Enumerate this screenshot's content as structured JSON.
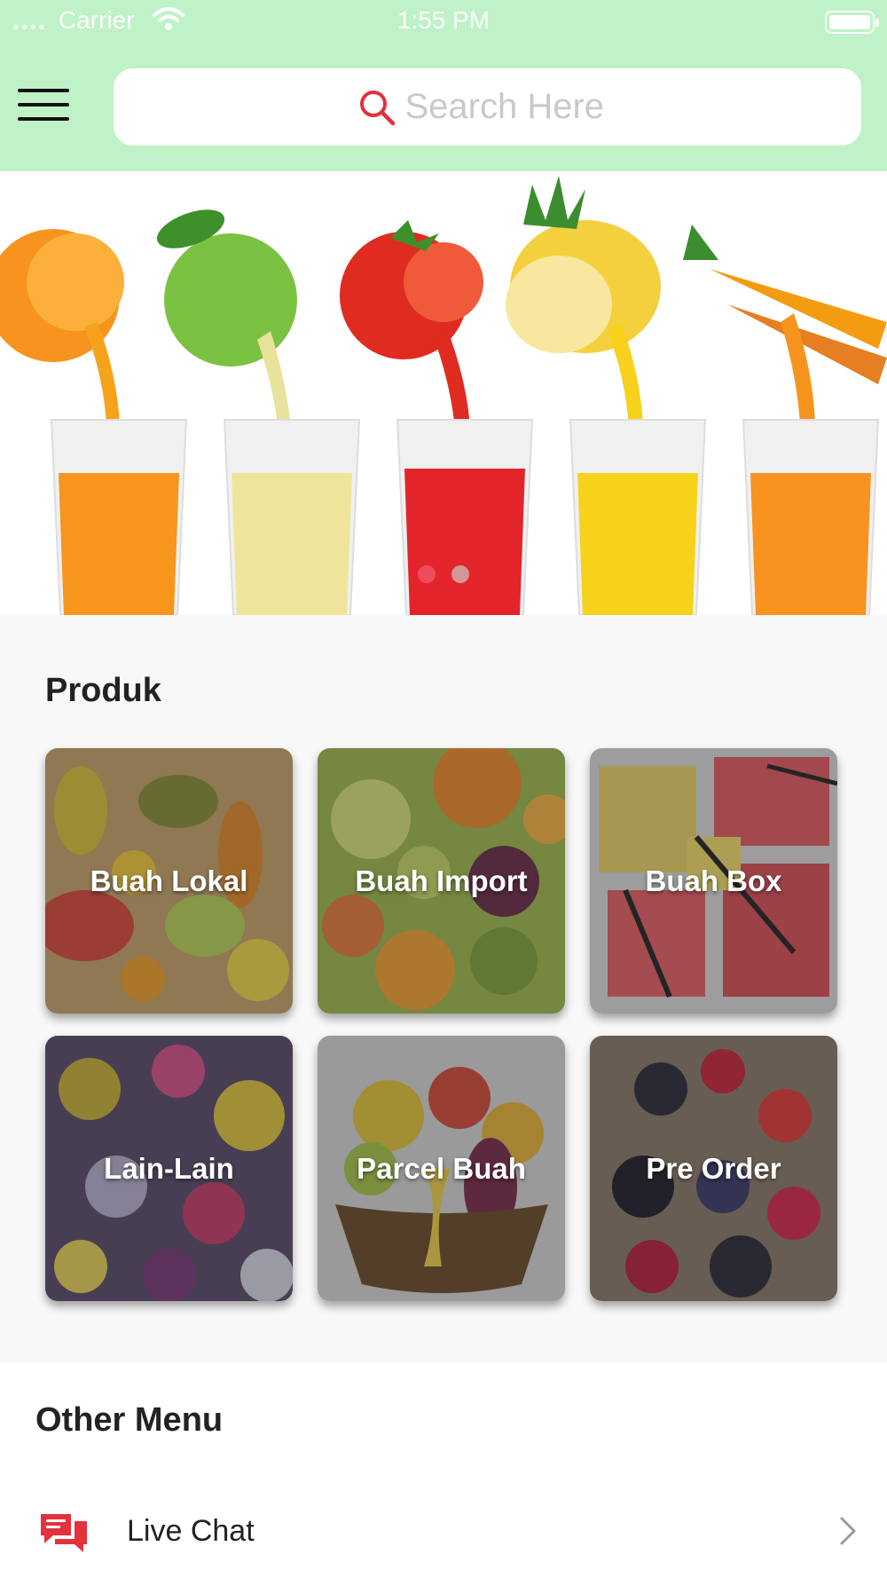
{
  "status_bar": {
    "carrier": "Carrier",
    "time": "1:55 PM"
  },
  "header": {
    "menu_icon": "hamburger-menu-icon",
    "search": {
      "placeholder": "Search Here",
      "value": "",
      "icon": "search-icon"
    },
    "background_color": "#bff2c6"
  },
  "banner": {
    "image": "fruit-juice-glasses-banner",
    "slides": 2,
    "active_slide": 1,
    "active_dot_color": "#f04b5a"
  },
  "produk": {
    "title": "Produk",
    "items": [
      {
        "label": "Buah Lokal"
      },
      {
        "label": "Buah Import"
      },
      {
        "label": "Buah Box"
      },
      {
        "label": "Lain-Lain"
      },
      {
        "label": "Parcel Buah"
      },
      {
        "label": "Pre Order"
      }
    ]
  },
  "other_menu": {
    "title": "Other Menu",
    "items": [
      {
        "label": "Live Chat",
        "icon": "chat-bubbles-icon",
        "trailing_icon": "chevron-right-icon"
      }
    ]
  },
  "colors": {
    "accent_red": "#e5303d"
  }
}
